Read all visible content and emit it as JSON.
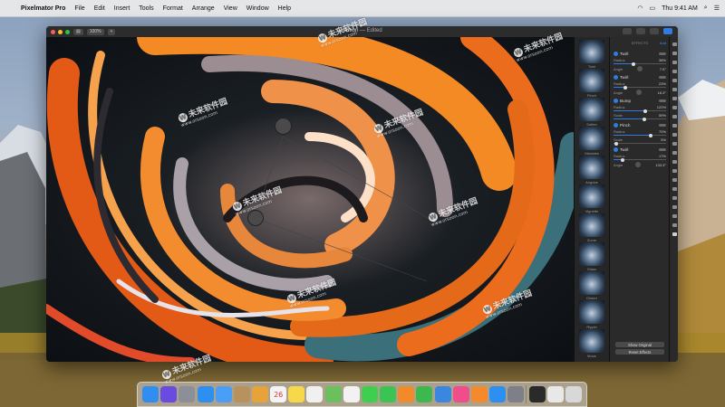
{
  "menubar": {
    "apple_icon": "apple-icon",
    "items": [
      "Pixelmator Pro",
      "File",
      "Edit",
      "Insert",
      "Tools",
      "Format",
      "Arrange",
      "View",
      "Window",
      "Help"
    ],
    "clock": "Thu 9:41 AM"
  },
  "window": {
    "zoom": "100%",
    "doc_title": "Motion",
    "doc_status": "Edited",
    "traffic_colors": [
      "#fc5f57",
      "#fdbc2e",
      "#28c840"
    ]
  },
  "presets": [
    {
      "label": "Twirl"
    },
    {
      "label": "Pinch"
    },
    {
      "label": "Soften"
    },
    {
      "label": "Mandala"
    },
    {
      "label": "Angular"
    },
    {
      "label": "Vignette"
    },
    {
      "label": "Zoom"
    },
    {
      "label": "Glass"
    },
    {
      "label": "Distort"
    },
    {
      "label": "Ripple"
    },
    {
      "label": "Move"
    }
  ],
  "effects": {
    "header": "EFFECTS",
    "add_label": "Add",
    "items": [
      {
        "name": "Twirl",
        "p1": "Radius",
        "v1": "38%",
        "f1": 0.38,
        "p2": "Angle",
        "v2": "7.5°"
      },
      {
        "name": "Twirl",
        "p1": "Radius",
        "v1": "23%",
        "f1": 0.23,
        "p2": "Angle",
        "v2": "16.3°"
      },
      {
        "name": "Bump",
        "p1": "Radius",
        "v1": "122%",
        "f1": 0.61,
        "p2": "Scale",
        "v2": "59%",
        "f2": 0.59
      },
      {
        "name": "Pinch",
        "p1": "Radius",
        "v1": "70%",
        "f1": 0.7,
        "p2": "Scale",
        "v2": "5%",
        "f2": 0.05
      },
      {
        "name": "Twirl",
        "p1": "Radius",
        "v1": "17%",
        "f1": 0.17,
        "p2": "Angle",
        "v2": "133.3°"
      }
    ],
    "show_original": "Show Original",
    "reset_effects": "Reset Effects"
  },
  "watermark": {
    "text": "未来软件园",
    "url": "www.orsoon.com",
    "logo": "W"
  },
  "dock": {
    "apps": [
      {
        "icon": "finder-icon",
        "color": "#2f8ef0"
      },
      {
        "icon": "siri-icon",
        "color": "#6a4be0"
      },
      {
        "icon": "launchpad-icon",
        "color": "#8a8f98"
      },
      {
        "icon": "safari-icon",
        "color": "#2d8ff0"
      },
      {
        "icon": "mail-icon",
        "color": "#4a9ef5"
      },
      {
        "icon": "contacts-icon",
        "color": "#b7925d"
      },
      {
        "icon": "photos-icon",
        "color": "#e8a23a"
      },
      {
        "icon": "calendar-icon",
        "color": "#f4f4f4",
        "text": "26"
      },
      {
        "icon": "notes-icon",
        "color": "#f7d84a"
      },
      {
        "icon": "reminders-icon",
        "color": "#f0f0f0"
      },
      {
        "icon": "maps-icon",
        "color": "#6cbf5d"
      },
      {
        "icon": "photos-app-icon",
        "color": "#f2f2f2"
      },
      {
        "icon": "messages-icon",
        "color": "#3fcf4f"
      },
      {
        "icon": "facetime-icon",
        "color": "#3cc453"
      },
      {
        "icon": "pages-icon",
        "color": "#f28a2a"
      },
      {
        "icon": "numbers-icon",
        "color": "#3cb84f"
      },
      {
        "icon": "keynote-icon",
        "color": "#3b87e0"
      },
      {
        "icon": "itunes-icon",
        "color": "#f04e8a"
      },
      {
        "icon": "ibooks-icon",
        "color": "#f48a2c"
      },
      {
        "icon": "app-store-icon",
        "color": "#2d8ff0"
      },
      {
        "icon": "system-preferences-icon",
        "color": "#7d8088"
      },
      {
        "icon": "pixelmator-icon",
        "color": "#2a2a2a"
      },
      {
        "icon": "downloads-icon",
        "color": "#e8e8e8"
      },
      {
        "icon": "trash-icon",
        "color": "#d8d8d8"
      }
    ]
  }
}
